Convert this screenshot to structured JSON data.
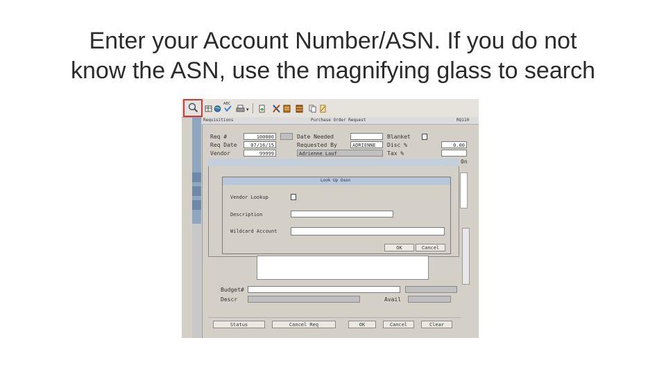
{
  "slide": {
    "title_line1": "Enter your Account Number/ASN. If you do not",
    "title_line2": "know the ASN, use the magnifying glass to search"
  },
  "app": {
    "left_tab": "Requisitions",
    "window_title": "Purchase Order Request",
    "form_code": "RQ110",
    "form": {
      "req_no_label": "Req #",
      "req_no_value": "100000",
      "req_date_label": "Req Date",
      "req_date_value": "07/16/15",
      "vendor_label": "Vendor",
      "vendor_value": "99999",
      "date_needed_label": "Date Needed",
      "requested_by_label": "Requested By",
      "requested_by_value": "ADRIENNE",
      "requested_by_value2": "Adrienne Lauf",
      "blanket_label": "Blanket",
      "disc_label": "Disc %",
      "disc_value": "0.00",
      "tax_label": "Tax %",
      "side_value": "0n"
    },
    "lower": {
      "budget_label": "Budget#",
      "descr_label": "Descr",
      "avail_label": "Avail"
    },
    "bottom_buttons": [
      "Status",
      "Cancel Req",
      "OK",
      "Cancel",
      "Clear"
    ]
  },
  "dialog": {
    "title": "Look Up Oasn",
    "vendor_lookup_label": "Vendor Lookup",
    "description_label": "Description",
    "wildcard_label": "Wildcard Account",
    "ok_label": "OK",
    "cancel_label": "Cancel"
  },
  "colors": {
    "highlight_box": "#e03030",
    "window_bg": "#d4d0c8",
    "dialog_header": "#b7c7db",
    "left_panel": "#8fa6bf"
  }
}
